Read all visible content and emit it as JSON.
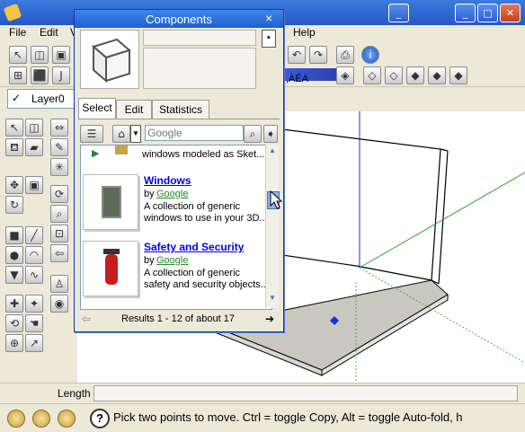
{
  "app": {
    "window_buttons": [
      "_",
      "□",
      "✕"
    ]
  },
  "menu": {
    "file": "File",
    "edit": "Edit",
    "view_partial": "V",
    "help": "Help"
  },
  "toolbar": {
    "partial_text": ",ÀÉA"
  },
  "layer": {
    "current": "Layer0",
    "check": "✓"
  },
  "measurements": {
    "label": "Length",
    "value": ""
  },
  "status": {
    "hint": "Pick two points to move.  Ctrl = toggle Copy, Alt = toggle Auto-fold, h",
    "help_glyph": "?"
  },
  "components_dialog": {
    "title": "Components",
    "close": "×",
    "tabs": [
      "Select",
      "Edit",
      "Statistics"
    ],
    "active_tab": "Select",
    "search": {
      "placeholder": "Google",
      "value": ""
    },
    "items": [
      {
        "name": "",
        "by_label": "",
        "author": "",
        "desc_line1": "windows modeled as Sket..."
      },
      {
        "name": "Windows",
        "by_label": "by",
        "author": "Google",
        "desc_line1": "A collection of generic",
        "desc_line2": "windows to use in your 3D..."
      },
      {
        "name": "Safety and Security",
        "by_label": "by",
        "author": "Google",
        "desc_line1": "A collection of generic",
        "desc_line2": "safety and security objects..."
      }
    ],
    "results_text": "Results 1 - 12 of about 17",
    "nav_prev": "⇦",
    "nav_next": "➔"
  },
  "colors": {
    "axis_blue": "#1e2fb8",
    "axis_green": "#22a822",
    "floor": "#c9c8c0",
    "titlebar": "#2458c8"
  }
}
